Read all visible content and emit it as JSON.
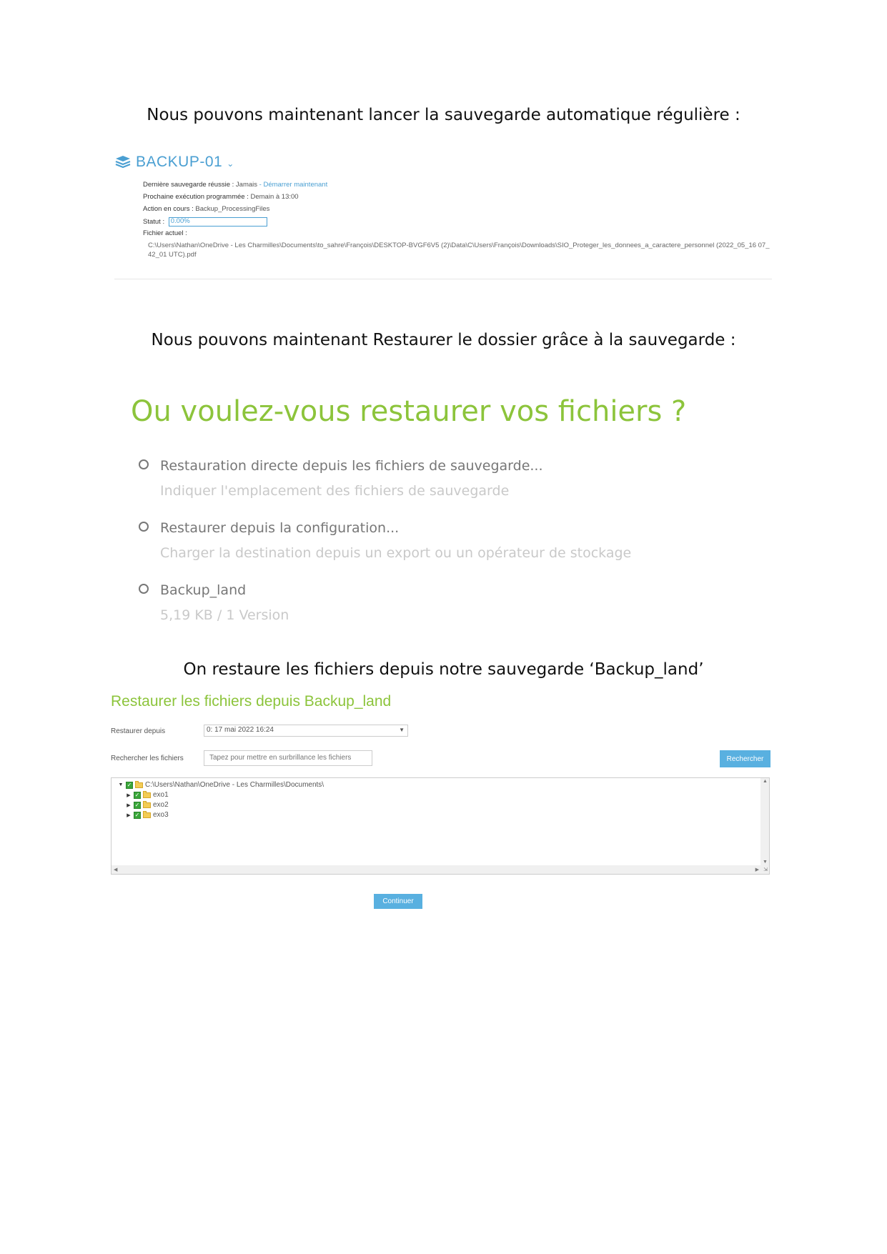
{
  "captions": {
    "launch": "Nous pouvons maintenant lancer la sauvegarde automatique régulière :",
    "restore": "Nous pouvons maintenant Restaurer le dossier grâce à la sauvegarde :",
    "source": "On restaure les fichiers depuis notre sauvegarde ‘Backup_land’"
  },
  "backup_job": {
    "name": "BACKUP-01",
    "last_success_label": "Dernière sauvegarde réussie :",
    "last_success_value": "Jamais",
    "separator": " - ",
    "start_now_link": "Démarrer maintenant",
    "next_run_label": "Prochaine exécution programmée :",
    "next_run_value": "Demain à 13:00",
    "current_action_label": "Action en cours :",
    "current_action_value": "Backup_ProcessingFiles",
    "status_label": "Statut :",
    "status_progress_text": "0.00%",
    "status_progress": 0.0,
    "current_file_label": "Fichier actuel :",
    "current_file_path": "C:\\Users\\Nathan\\OneDrive - Les Charmilles\\Documents\\to_sahre\\François\\DESKTOP-BVGF6V5 (2)\\Data\\C\\Users\\François\\Downloads\\SIO_Proteger_les_donnees_a_caractere_personnel (2022_05_16 07_42_01 UTC).pdf"
  },
  "restore_choice": {
    "heading": "Ou voulez-vous restaurer vos fichiers ?",
    "options": [
      {
        "title": "Restauration directe depuis les fichiers de sauvegarde...",
        "subtitle": "Indiquer l'emplacement des fichiers de sauvegarde"
      },
      {
        "title": "Restaurer depuis la configuration...",
        "subtitle": "Charger la destination depuis un export ou un opérateur de stockage"
      },
      {
        "title": "Backup_land",
        "subtitle": "5,19 KB / 1 Version"
      }
    ]
  },
  "restore_files": {
    "title": "Restaurer les fichiers depuis Backup_land",
    "restore_from_label": "Restaurer depuis",
    "restore_from_value": "0: 17 mai 2022 16:24",
    "search_label": "Rechercher les fichiers",
    "search_placeholder": "Tapez pour mettre en surbrillance les fichiers",
    "search_button": "Rechercher",
    "tree": {
      "root": "C:\\Users\\Nathan\\OneDrive - Les Charmilles\\Documents\\",
      "children": [
        "exo1",
        "exo2",
        "exo3"
      ]
    },
    "continue_button": "Continuer"
  },
  "colors": {
    "accent_blue": "#4a9fd2",
    "accent_green": "#8cc43b",
    "button_blue": "#59b0e0",
    "check_green": "#3aa63a"
  },
  "icons": {
    "backup": "stack-layers-icon",
    "chevron": "chevron-down-icon",
    "radio": "radio-button-icon",
    "folder": "folder-icon",
    "checkbox": "checkbox-checked-icon"
  }
}
